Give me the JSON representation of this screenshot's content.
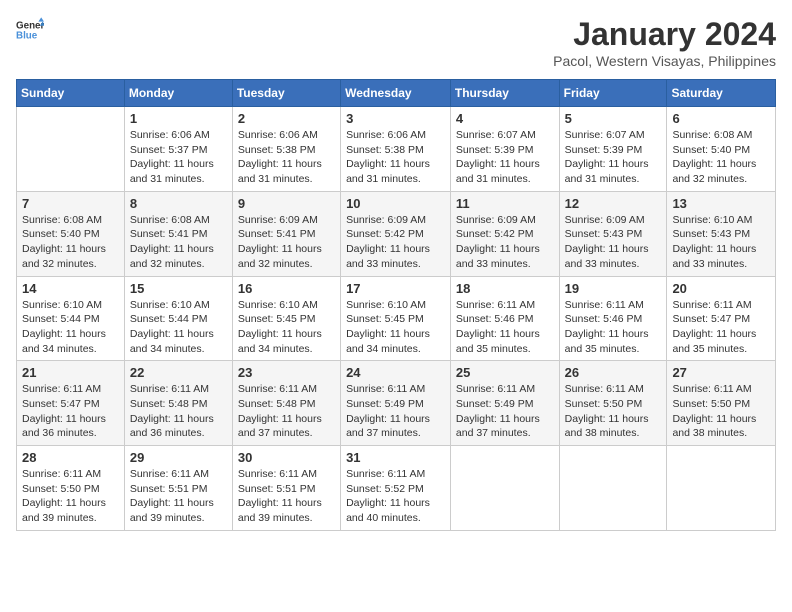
{
  "header": {
    "logo_general": "General",
    "logo_blue": "Blue",
    "title": "January 2024",
    "subtitle": "Pacol, Western Visayas, Philippines"
  },
  "weekdays": [
    "Sunday",
    "Monday",
    "Tuesday",
    "Wednesday",
    "Thursday",
    "Friday",
    "Saturday"
  ],
  "weeks": [
    [
      {
        "day": "",
        "sunrise": "",
        "sunset": "",
        "daylight": ""
      },
      {
        "day": "1",
        "sunrise": "Sunrise: 6:06 AM",
        "sunset": "Sunset: 5:37 PM",
        "daylight": "Daylight: 11 hours and 31 minutes."
      },
      {
        "day": "2",
        "sunrise": "Sunrise: 6:06 AM",
        "sunset": "Sunset: 5:38 PM",
        "daylight": "Daylight: 11 hours and 31 minutes."
      },
      {
        "day": "3",
        "sunrise": "Sunrise: 6:06 AM",
        "sunset": "Sunset: 5:38 PM",
        "daylight": "Daylight: 11 hours and 31 minutes."
      },
      {
        "day": "4",
        "sunrise": "Sunrise: 6:07 AM",
        "sunset": "Sunset: 5:39 PM",
        "daylight": "Daylight: 11 hours and 31 minutes."
      },
      {
        "day": "5",
        "sunrise": "Sunrise: 6:07 AM",
        "sunset": "Sunset: 5:39 PM",
        "daylight": "Daylight: 11 hours and 31 minutes."
      },
      {
        "day": "6",
        "sunrise": "Sunrise: 6:08 AM",
        "sunset": "Sunset: 5:40 PM",
        "daylight": "Daylight: 11 hours and 32 minutes."
      }
    ],
    [
      {
        "day": "7",
        "sunrise": "Sunrise: 6:08 AM",
        "sunset": "Sunset: 5:40 PM",
        "daylight": "Daylight: 11 hours and 32 minutes."
      },
      {
        "day": "8",
        "sunrise": "Sunrise: 6:08 AM",
        "sunset": "Sunset: 5:41 PM",
        "daylight": "Daylight: 11 hours and 32 minutes."
      },
      {
        "day": "9",
        "sunrise": "Sunrise: 6:09 AM",
        "sunset": "Sunset: 5:41 PM",
        "daylight": "Daylight: 11 hours and 32 minutes."
      },
      {
        "day": "10",
        "sunrise": "Sunrise: 6:09 AM",
        "sunset": "Sunset: 5:42 PM",
        "daylight": "Daylight: 11 hours and 33 minutes."
      },
      {
        "day": "11",
        "sunrise": "Sunrise: 6:09 AM",
        "sunset": "Sunset: 5:42 PM",
        "daylight": "Daylight: 11 hours and 33 minutes."
      },
      {
        "day": "12",
        "sunrise": "Sunrise: 6:09 AM",
        "sunset": "Sunset: 5:43 PM",
        "daylight": "Daylight: 11 hours and 33 minutes."
      },
      {
        "day": "13",
        "sunrise": "Sunrise: 6:10 AM",
        "sunset": "Sunset: 5:43 PM",
        "daylight": "Daylight: 11 hours and 33 minutes."
      }
    ],
    [
      {
        "day": "14",
        "sunrise": "Sunrise: 6:10 AM",
        "sunset": "Sunset: 5:44 PM",
        "daylight": "Daylight: 11 hours and 34 minutes."
      },
      {
        "day": "15",
        "sunrise": "Sunrise: 6:10 AM",
        "sunset": "Sunset: 5:44 PM",
        "daylight": "Daylight: 11 hours and 34 minutes."
      },
      {
        "day": "16",
        "sunrise": "Sunrise: 6:10 AM",
        "sunset": "Sunset: 5:45 PM",
        "daylight": "Daylight: 11 hours and 34 minutes."
      },
      {
        "day": "17",
        "sunrise": "Sunrise: 6:10 AM",
        "sunset": "Sunset: 5:45 PM",
        "daylight": "Daylight: 11 hours and 34 minutes."
      },
      {
        "day": "18",
        "sunrise": "Sunrise: 6:11 AM",
        "sunset": "Sunset: 5:46 PM",
        "daylight": "Daylight: 11 hours and 35 minutes."
      },
      {
        "day": "19",
        "sunrise": "Sunrise: 6:11 AM",
        "sunset": "Sunset: 5:46 PM",
        "daylight": "Daylight: 11 hours and 35 minutes."
      },
      {
        "day": "20",
        "sunrise": "Sunrise: 6:11 AM",
        "sunset": "Sunset: 5:47 PM",
        "daylight": "Daylight: 11 hours and 35 minutes."
      }
    ],
    [
      {
        "day": "21",
        "sunrise": "Sunrise: 6:11 AM",
        "sunset": "Sunset: 5:47 PM",
        "daylight": "Daylight: 11 hours and 36 minutes."
      },
      {
        "day": "22",
        "sunrise": "Sunrise: 6:11 AM",
        "sunset": "Sunset: 5:48 PM",
        "daylight": "Daylight: 11 hours and 36 minutes."
      },
      {
        "day": "23",
        "sunrise": "Sunrise: 6:11 AM",
        "sunset": "Sunset: 5:48 PM",
        "daylight": "Daylight: 11 hours and 37 minutes."
      },
      {
        "day": "24",
        "sunrise": "Sunrise: 6:11 AM",
        "sunset": "Sunset: 5:49 PM",
        "daylight": "Daylight: 11 hours and 37 minutes."
      },
      {
        "day": "25",
        "sunrise": "Sunrise: 6:11 AM",
        "sunset": "Sunset: 5:49 PM",
        "daylight": "Daylight: 11 hours and 37 minutes."
      },
      {
        "day": "26",
        "sunrise": "Sunrise: 6:11 AM",
        "sunset": "Sunset: 5:50 PM",
        "daylight": "Daylight: 11 hours and 38 minutes."
      },
      {
        "day": "27",
        "sunrise": "Sunrise: 6:11 AM",
        "sunset": "Sunset: 5:50 PM",
        "daylight": "Daylight: 11 hours and 38 minutes."
      }
    ],
    [
      {
        "day": "28",
        "sunrise": "Sunrise: 6:11 AM",
        "sunset": "Sunset: 5:50 PM",
        "daylight": "Daylight: 11 hours and 39 minutes."
      },
      {
        "day": "29",
        "sunrise": "Sunrise: 6:11 AM",
        "sunset": "Sunset: 5:51 PM",
        "daylight": "Daylight: 11 hours and 39 minutes."
      },
      {
        "day": "30",
        "sunrise": "Sunrise: 6:11 AM",
        "sunset": "Sunset: 5:51 PM",
        "daylight": "Daylight: 11 hours and 39 minutes."
      },
      {
        "day": "31",
        "sunrise": "Sunrise: 6:11 AM",
        "sunset": "Sunset: 5:52 PM",
        "daylight": "Daylight: 11 hours and 40 minutes."
      },
      {
        "day": "",
        "sunrise": "",
        "sunset": "",
        "daylight": ""
      },
      {
        "day": "",
        "sunrise": "",
        "sunset": "",
        "daylight": ""
      },
      {
        "day": "",
        "sunrise": "",
        "sunset": "",
        "daylight": ""
      }
    ]
  ]
}
